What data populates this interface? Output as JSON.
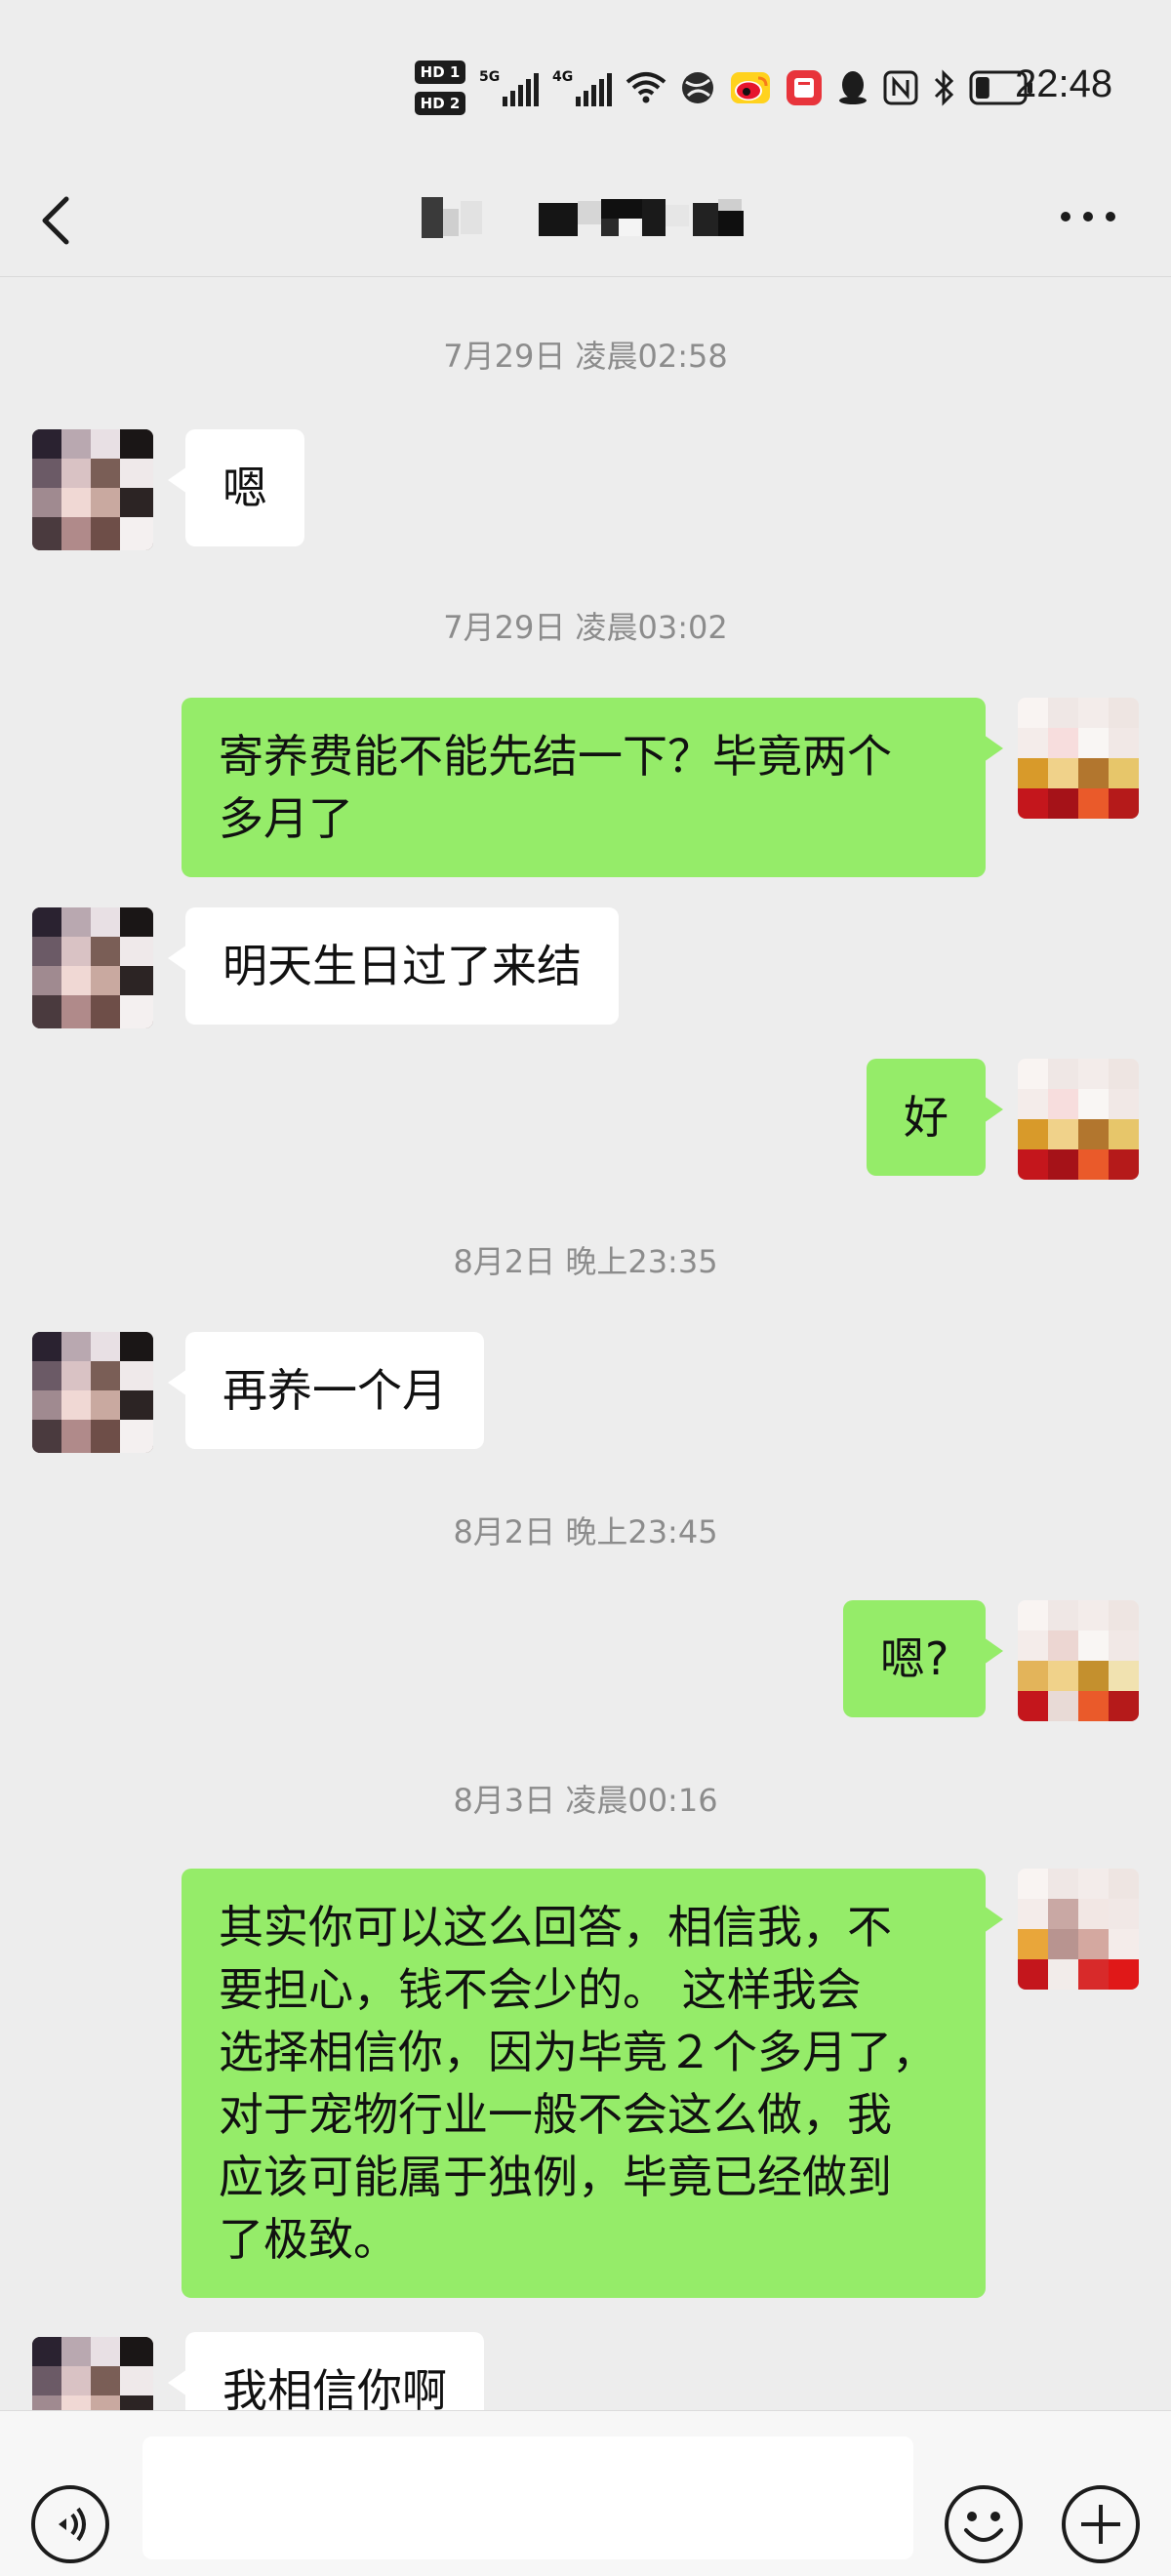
{
  "status_bar": {
    "time": "22:48",
    "sim1_label": "HD 1",
    "sim2_label": "HD 2",
    "network1": "5G",
    "network2": "4G",
    "icons": [
      "hd-icon",
      "signal-5g-icon",
      "signal-4g-icon",
      "wifi-icon",
      "browser-icon",
      "weibo-icon",
      "book-app-icon",
      "qq-icon",
      "nfc-icon",
      "bluetooth-icon",
      "battery-icon"
    ],
    "battery_level": 0.3
  },
  "nav": {
    "back_icon": "chevron-left-icon",
    "title": "",
    "more_icon": "more-dots-icon"
  },
  "chat": {
    "messages": [
      {
        "type": "timestamp",
        "text": "7月29日 凌晨02:58"
      },
      {
        "type": "incoming",
        "text": "嗯"
      },
      {
        "type": "timestamp",
        "text": "7月29日 凌晨03:02"
      },
      {
        "type": "outgoing",
        "lines": [
          "寄养费能不能先结一下？毕竟两个",
          "多月了"
        ]
      },
      {
        "type": "incoming",
        "text": "明天生日过了来结"
      },
      {
        "type": "outgoing",
        "text": "好"
      },
      {
        "type": "timestamp",
        "text": "8月2日 晚上23:35"
      },
      {
        "type": "incoming",
        "text": "再养一个月"
      },
      {
        "type": "timestamp",
        "text": "8月2日 晚上23:45"
      },
      {
        "type": "outgoing",
        "text": "嗯?"
      },
      {
        "type": "timestamp",
        "text": "8月3日 凌晨00:16"
      },
      {
        "type": "outgoing",
        "lines": [
          "其实你可以这么回答，相信我，不",
          "要担心，钱不会少的。  这样我会",
          "选择相信你，因为毕竟２个多月了，",
          "对于宠物行业一般不会这么做，我",
          "应该可能属于独例，毕竟已经做到",
          "了极致。"
        ]
      },
      {
        "type": "incoming",
        "text": "我相信你啊"
      }
    ]
  },
  "input_bar": {
    "voice_icon": "voice-icon",
    "input_value": "",
    "input_placeholder": "",
    "emoji_icon": "emoji-icon",
    "plus_icon": "plus-icon"
  },
  "colors": {
    "background": "#ededed",
    "outgoing_bubble": "#95ec69",
    "incoming_bubble": "#ffffff",
    "timestamp_text": "#8c8c8c"
  }
}
